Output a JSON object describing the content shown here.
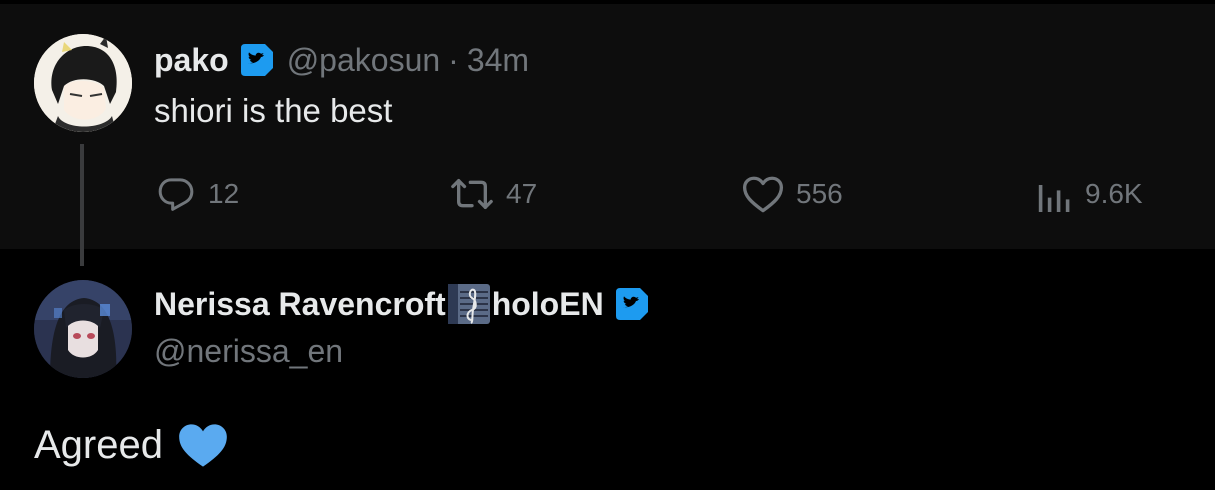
{
  "parent_tweet": {
    "display_name": "pako",
    "handle": "@pakosun",
    "separator": "·",
    "time": "34m",
    "text": "shiori is the best",
    "stats": {
      "replies": "12",
      "retweets": "47",
      "likes": "556",
      "views": "9.6K"
    }
  },
  "reply_tweet": {
    "display_name": "Nerissa Ravencroft",
    "display_name_suffix": "holoEN",
    "handle": "@nerissa_en",
    "text": "Agreed"
  },
  "colors": {
    "background": "#000000",
    "parent_background": "#0d0d0d",
    "primary_text": "#e7e9ea",
    "secondary_text": "#71767b",
    "verified_badge": "#1d9bf0",
    "heart_emoji": "#5aaaf0",
    "thread_line": "#3a3b3d"
  },
  "icons": {
    "verified": "twitter-bird-badge",
    "reply": "speech-bubble-icon",
    "retweet": "retweet-icon",
    "like": "heart-outline-icon",
    "views": "bar-chart-icon",
    "name_emoji": "musical-score-emoji",
    "body_emoji": "blue-heart-emoji"
  }
}
